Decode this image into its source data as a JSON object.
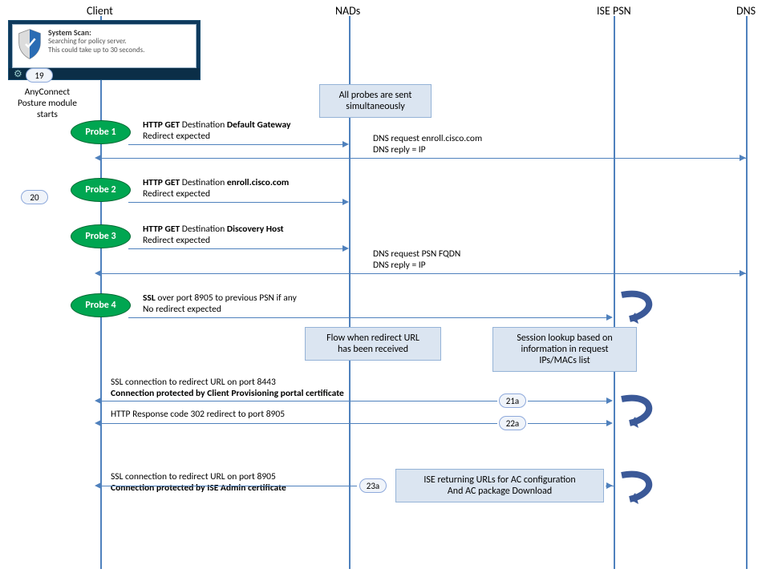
{
  "actors": {
    "client": "Client",
    "nad": "NADs",
    "psn": "ISE PSN",
    "dns": "DNS"
  },
  "anyconnect_label": "AnyConnect\nPosture module\nstarts",
  "screenshot": {
    "title": "System Scan:",
    "line1": "Searching for policy server.",
    "line2": "This could take up to 30 seconds."
  },
  "steps": {
    "s19": "19",
    "s20": "20",
    "s21a": "21a",
    "s22a": "22a",
    "s23a": "23a"
  },
  "probes": {
    "p1": "Probe 1",
    "p2": "Probe 2",
    "p3": "Probe 3",
    "p4": "Probe 4"
  },
  "notes": {
    "simultaneous": "All probes are sent\nsimultaneously",
    "flow": "Flow when redirect URL\nhas been received",
    "session": "Session lookup based on\ninformation in request\nIPs/MACs list",
    "urls": "ISE returning URLs for AC configuration\nAnd AC package Download"
  },
  "msgs": {
    "p1a": "HTTP GET",
    "p1b": "Destination",
    "p1c": "Default Gateway",
    "redirect": "Redirect expected",
    "dnsEnroll1": "DNS request enroll.cisco.com",
    "dnsEnroll2": "DNS reply = IP",
    "p2a": "HTTP GET",
    "p2b": "Destination",
    "p2c": "enroll.cisco.com",
    "p3a": "HTTP GET",
    "p3b": "Destination",
    "p3c": "Discovery Host",
    "dnsFqdn1": "DNS request PSN FQDN",
    "p4a": "SSL",
    "p4b": "over port 8905 to previous PSN if any",
    "p4nor": "No redirect expected",
    "ssl8443": "SSL connection to redirect URL on port 8443",
    "connCP": "Connection protected by Client Provisioning  portal certificate",
    "http302": "HTTP Response code 302 redirect to port 8905",
    "ssl8905": "SSL connection to redirect URL on port 8905",
    "connAdmin": "Connection protected by ISE Admin certificate"
  }
}
